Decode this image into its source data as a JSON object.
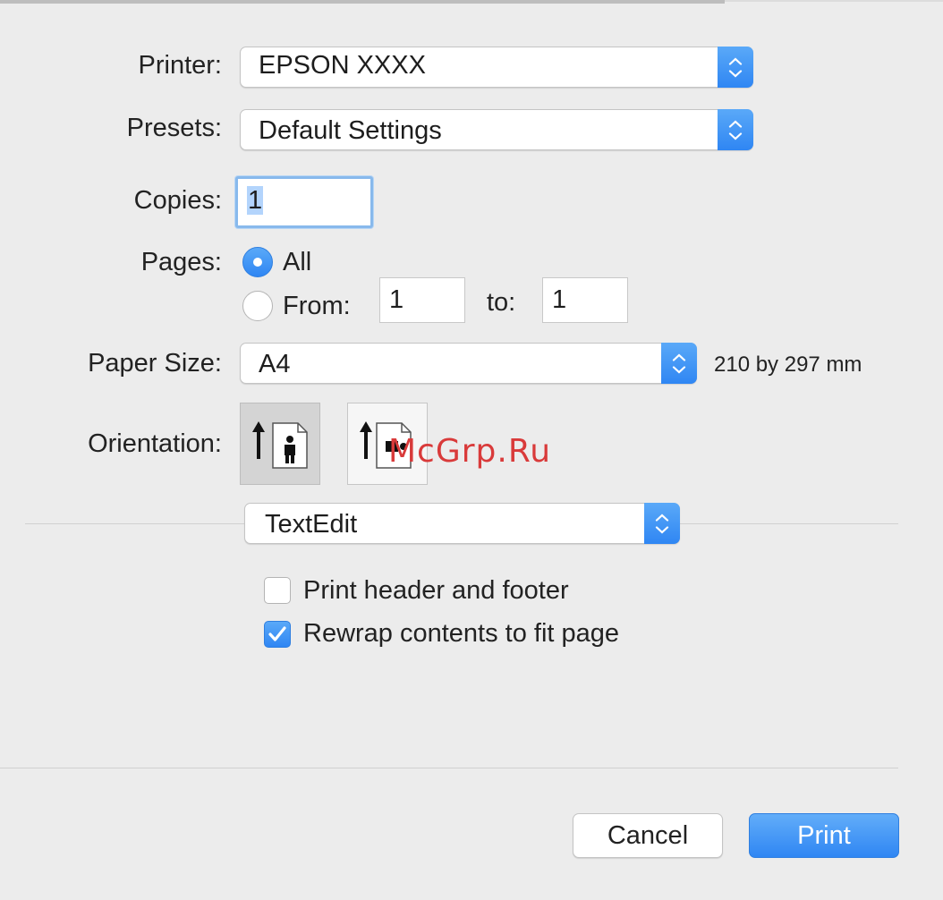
{
  "printer": {
    "label": "Printer:",
    "value": "EPSON XXXX"
  },
  "presets": {
    "label": "Presets:",
    "value": "Default Settings"
  },
  "copies": {
    "label": "Copies:",
    "value": "1"
  },
  "pages": {
    "label": "Pages:",
    "all_label": "All",
    "from_label": "From:",
    "from_value": "1",
    "to_label": "to:",
    "to_value": "1",
    "selected": "All"
  },
  "paper_size": {
    "label": "Paper Size:",
    "value": "A4",
    "dimensions": "210 by 297 mm"
  },
  "orientation": {
    "label": "Orientation:",
    "selected": "portrait"
  },
  "app_section": {
    "value": "TextEdit"
  },
  "options": [
    {
      "label": "Print header and footer",
      "checked": false
    },
    {
      "label": "Rewrap contents to fit page",
      "checked": true
    }
  ],
  "buttons": {
    "cancel": "Cancel",
    "print": "Print"
  },
  "watermark": "McGrp.Ru",
  "colors": {
    "accent": "#2f86f3",
    "background": "#ececec"
  },
  "icons": {
    "popup": "up-down-chevron-icon",
    "portrait": "portrait-orientation-icon",
    "landscape": "landscape-orientation-icon",
    "check": "checkmark-icon"
  }
}
